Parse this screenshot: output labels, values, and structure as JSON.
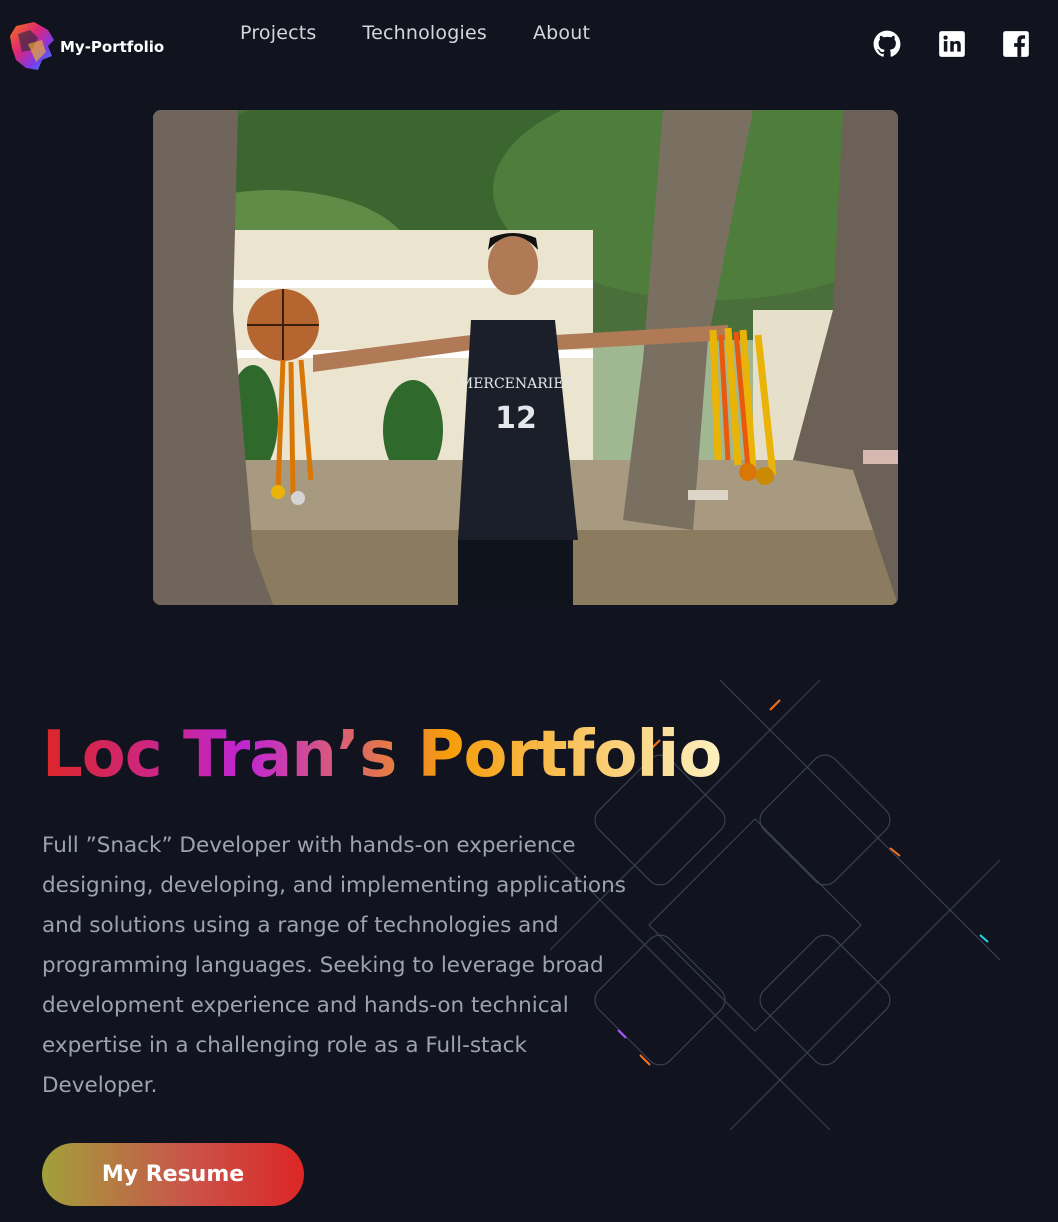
{
  "nav": {
    "logo_text": "My-Portfolio",
    "links": [
      "Projects",
      "Technologies",
      "About"
    ],
    "social_icons": [
      "github-icon",
      "linkedin-icon",
      "facebook-icon"
    ]
  },
  "hero": {
    "title": "Loc Tran’s Portfolio",
    "bio": "Full ”Snack” Developer with hands-on experience designing, developing, and implementing applications and solutions using a range of technologies and programming languages. Seeking to leverage broad development experience and hands-on technical expertise in a challenging role as a Full-stack Developer.",
    "resume_button": "My Resume",
    "jersey_text": "MERCENARIES",
    "jersey_number": "12"
  },
  "colors": {
    "background": "#11131f",
    "title_gradient": [
      "#dc2626",
      "#c026d3",
      "#f59e0b",
      "#fdf0c0"
    ],
    "button_gradient": [
      "#a1a03a",
      "#dc2626"
    ]
  }
}
